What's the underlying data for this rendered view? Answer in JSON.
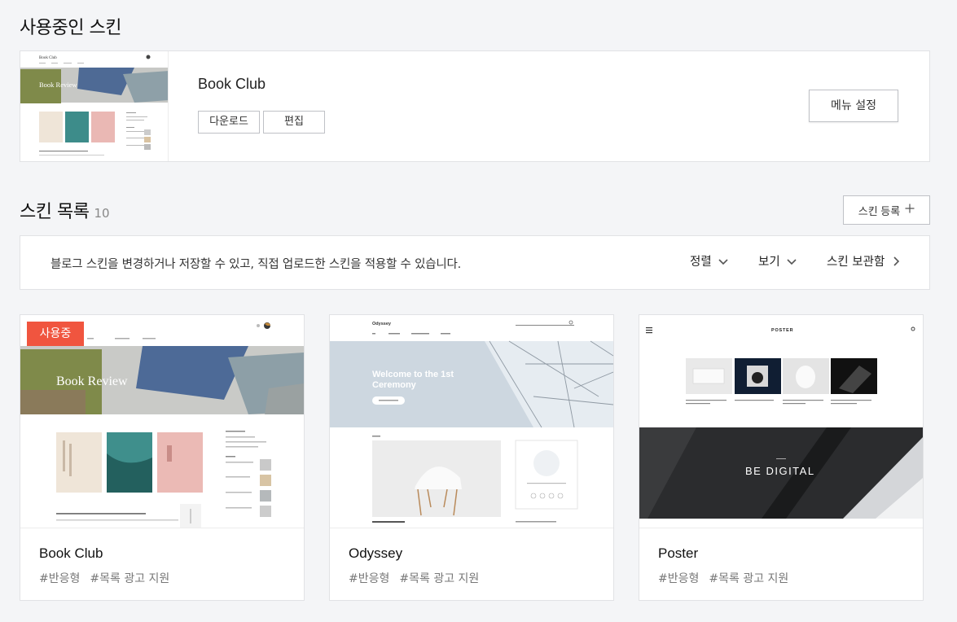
{
  "current_section": {
    "title": "사용중인 스킨",
    "skin_name": "Book Club",
    "download_label": "다운로드",
    "edit_label": "편집",
    "menu_settings_label": "메뉴 설정",
    "thumbnail_text": {
      "brand": "Book Club",
      "hero": "Book Review"
    }
  },
  "list_section": {
    "title": "스킨 목록",
    "count": "10",
    "register_label": "스킨 등록",
    "register_icon": "plus-icon"
  },
  "info_bar": {
    "description": "블로그 스킨을 변경하거나 저장할 수 있고, 직접 업로드한 스킨을 적용할 수 있습니다.",
    "sort_label": "정렬",
    "view_label": "보기",
    "archive_label": "스킨 보관함"
  },
  "skins": [
    {
      "name": "Book Club",
      "tags": [
        "#반응형",
        "#목록 광고 지원"
      ],
      "badge": "사용중",
      "preview": {
        "hero": "Book Review"
      }
    },
    {
      "name": "Odyssey",
      "tags": [
        "#반응형",
        "#목록 광고 지원"
      ],
      "preview": {
        "brand": "Odyssey",
        "hero_line1": "Welcome to the 1st",
        "hero_line2": "Ceremony"
      }
    },
    {
      "name": "Poster",
      "tags": [
        "#반응형",
        "#목록 광고 지원"
      ],
      "preview": {
        "brand": "POSTER",
        "banner": "BE DIGITAL"
      }
    }
  ],
  "colors": {
    "badge": "#f0553f",
    "background": "#f4f5f7",
    "border": "#e1e2e5"
  }
}
